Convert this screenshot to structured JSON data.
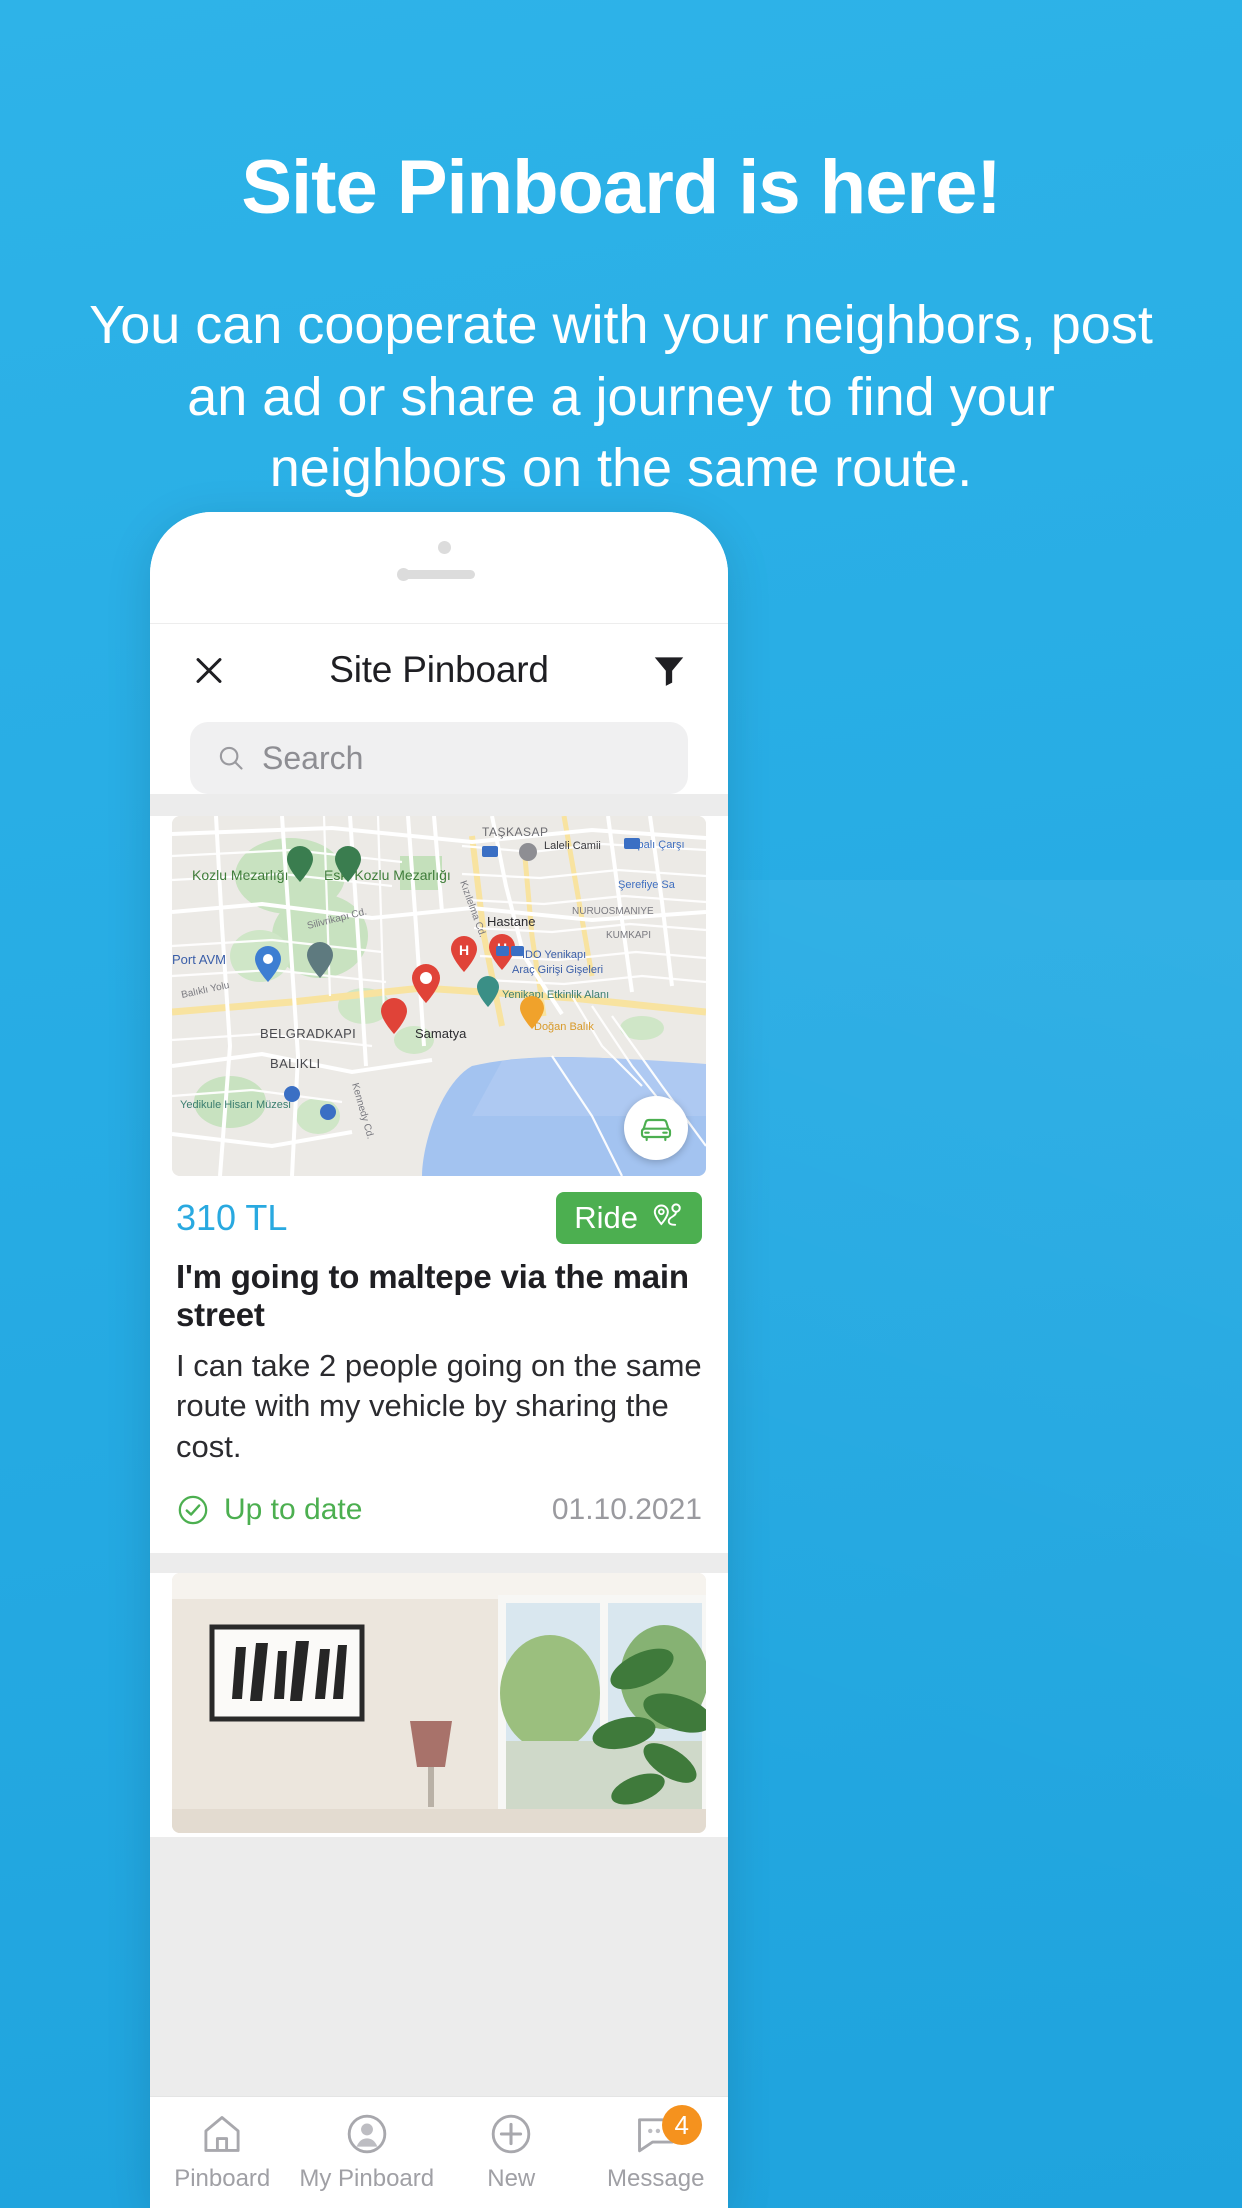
{
  "promo": {
    "title": "Site Pinboard is here!",
    "subtitle": "You can cooperate with your neighbors, post an ad or share a journey to find your neighbors on the same route."
  },
  "colors": {
    "background": "#29ace4",
    "accent_blue": "#29a9e0",
    "green": "#4caf50",
    "badge_orange": "#f5921e"
  },
  "app": {
    "header": {
      "close_label": "close-icon",
      "title": "Site Pinboard",
      "filter_label": "filter-icon"
    },
    "search": {
      "placeholder": "Search",
      "value": ""
    },
    "cards": [
      {
        "price": "310 TL",
        "badge": "Ride",
        "title": "I'm going to maltepe via the main street",
        "description": "I can take 2 people going on the same route with my vehicle by sharing the cost.",
        "status": "Up to date",
        "date": "01.10.2021",
        "map_labels": {
          "places": [
            "Kozlu Mezarlığı",
            "Eski Kozlu Mezarlığı",
            "TAŞKASAP",
            "Laleli Camii",
            "Kapalı Çarşı",
            "Şerefiye Sa",
            "NURUOSMANIYE",
            "Hastane",
            "İDO Yenikapı",
            "Araç Girişi Gişeleri",
            "KUMKAPI",
            "Yenikapı Etkinlik Alanı",
            "Port AVM",
            "Doğan Balık",
            "Samatya",
            "BELGRADKAPI",
            "BALIKLI",
            "Yedikule Hisarı Müzesi"
          ],
          "streets": [
            "Silivrikapı Cd.",
            "Kızılelma Cd.",
            "Balıklı Yolu",
            "Kennedy Cd."
          ]
        }
      },
      {
        "image_alt": "living-room-photo"
      }
    ],
    "tabs": [
      {
        "label": "Pinboard",
        "icon": "home-icon",
        "badge": ""
      },
      {
        "label": "My Pinboard",
        "icon": "person-icon",
        "badge": ""
      },
      {
        "label": "New",
        "icon": "plus-icon",
        "badge": ""
      },
      {
        "label": "Message",
        "icon": "message-icon",
        "badge": "4"
      }
    ]
  }
}
